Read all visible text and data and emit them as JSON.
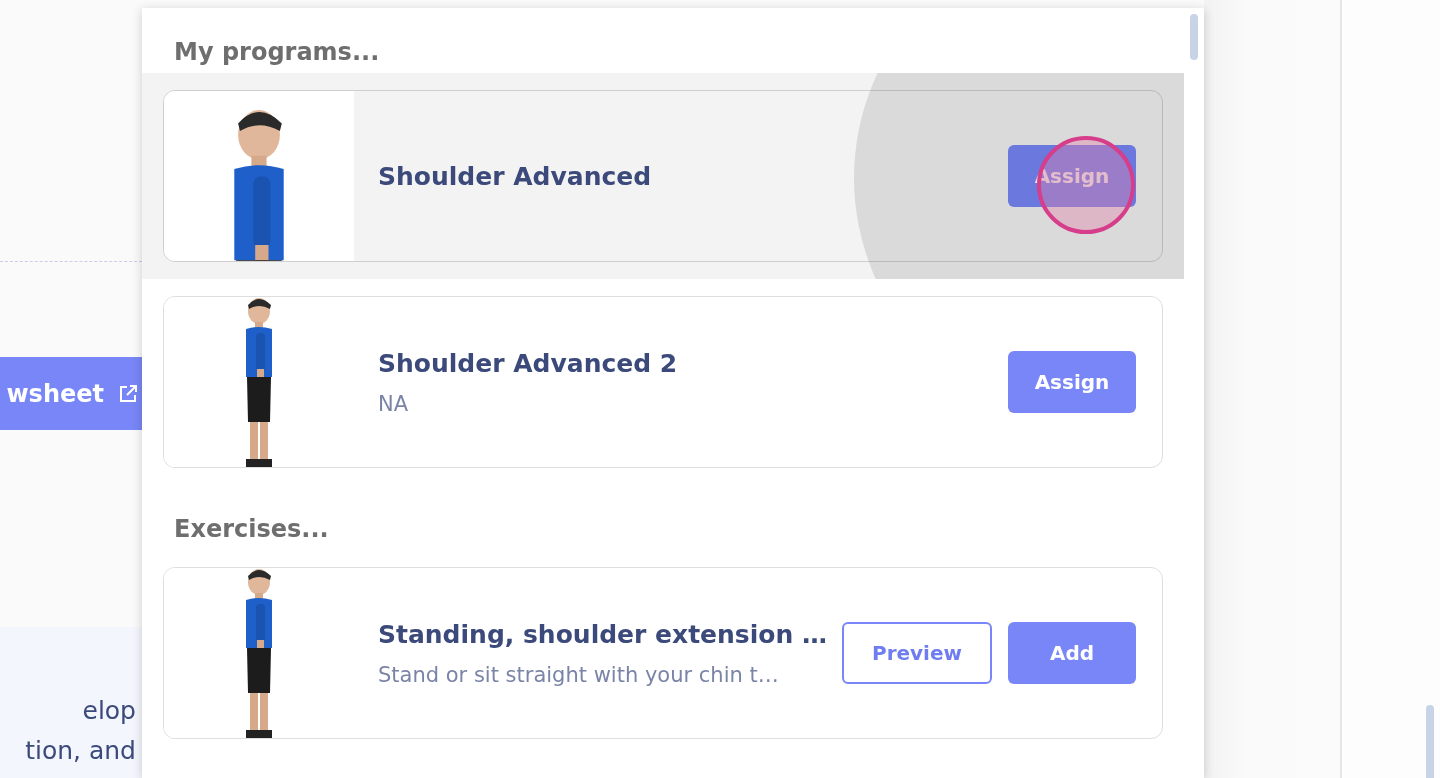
{
  "left_panel": {
    "button": {
      "label": "wsheet"
    },
    "text_lines": [
      "elop",
      "tion, and"
    ]
  },
  "dropdown": {
    "sections": [
      {
        "heading": "My programs...",
        "items": [
          {
            "title": "Shoulder Advanced",
            "highlighted": true,
            "buttons": [
              {
                "label": "Assign",
                "kind": "filled"
              }
            ]
          },
          {
            "title": "Shoulder Advanced 2",
            "description": "NA",
            "highlighted": false,
            "buttons": [
              {
                "label": "Assign",
                "kind": "filled"
              }
            ]
          }
        ]
      },
      {
        "heading": "Exercises...",
        "items": [
          {
            "title": "Standing, shoulder extension …",
            "description": "Stand or sit straight with your chin t…",
            "highlighted": false,
            "buttons": [
              {
                "label": "Preview",
                "kind": "outline"
              },
              {
                "label": "Add",
                "kind": "filled"
              }
            ]
          }
        ]
      }
    ]
  }
}
